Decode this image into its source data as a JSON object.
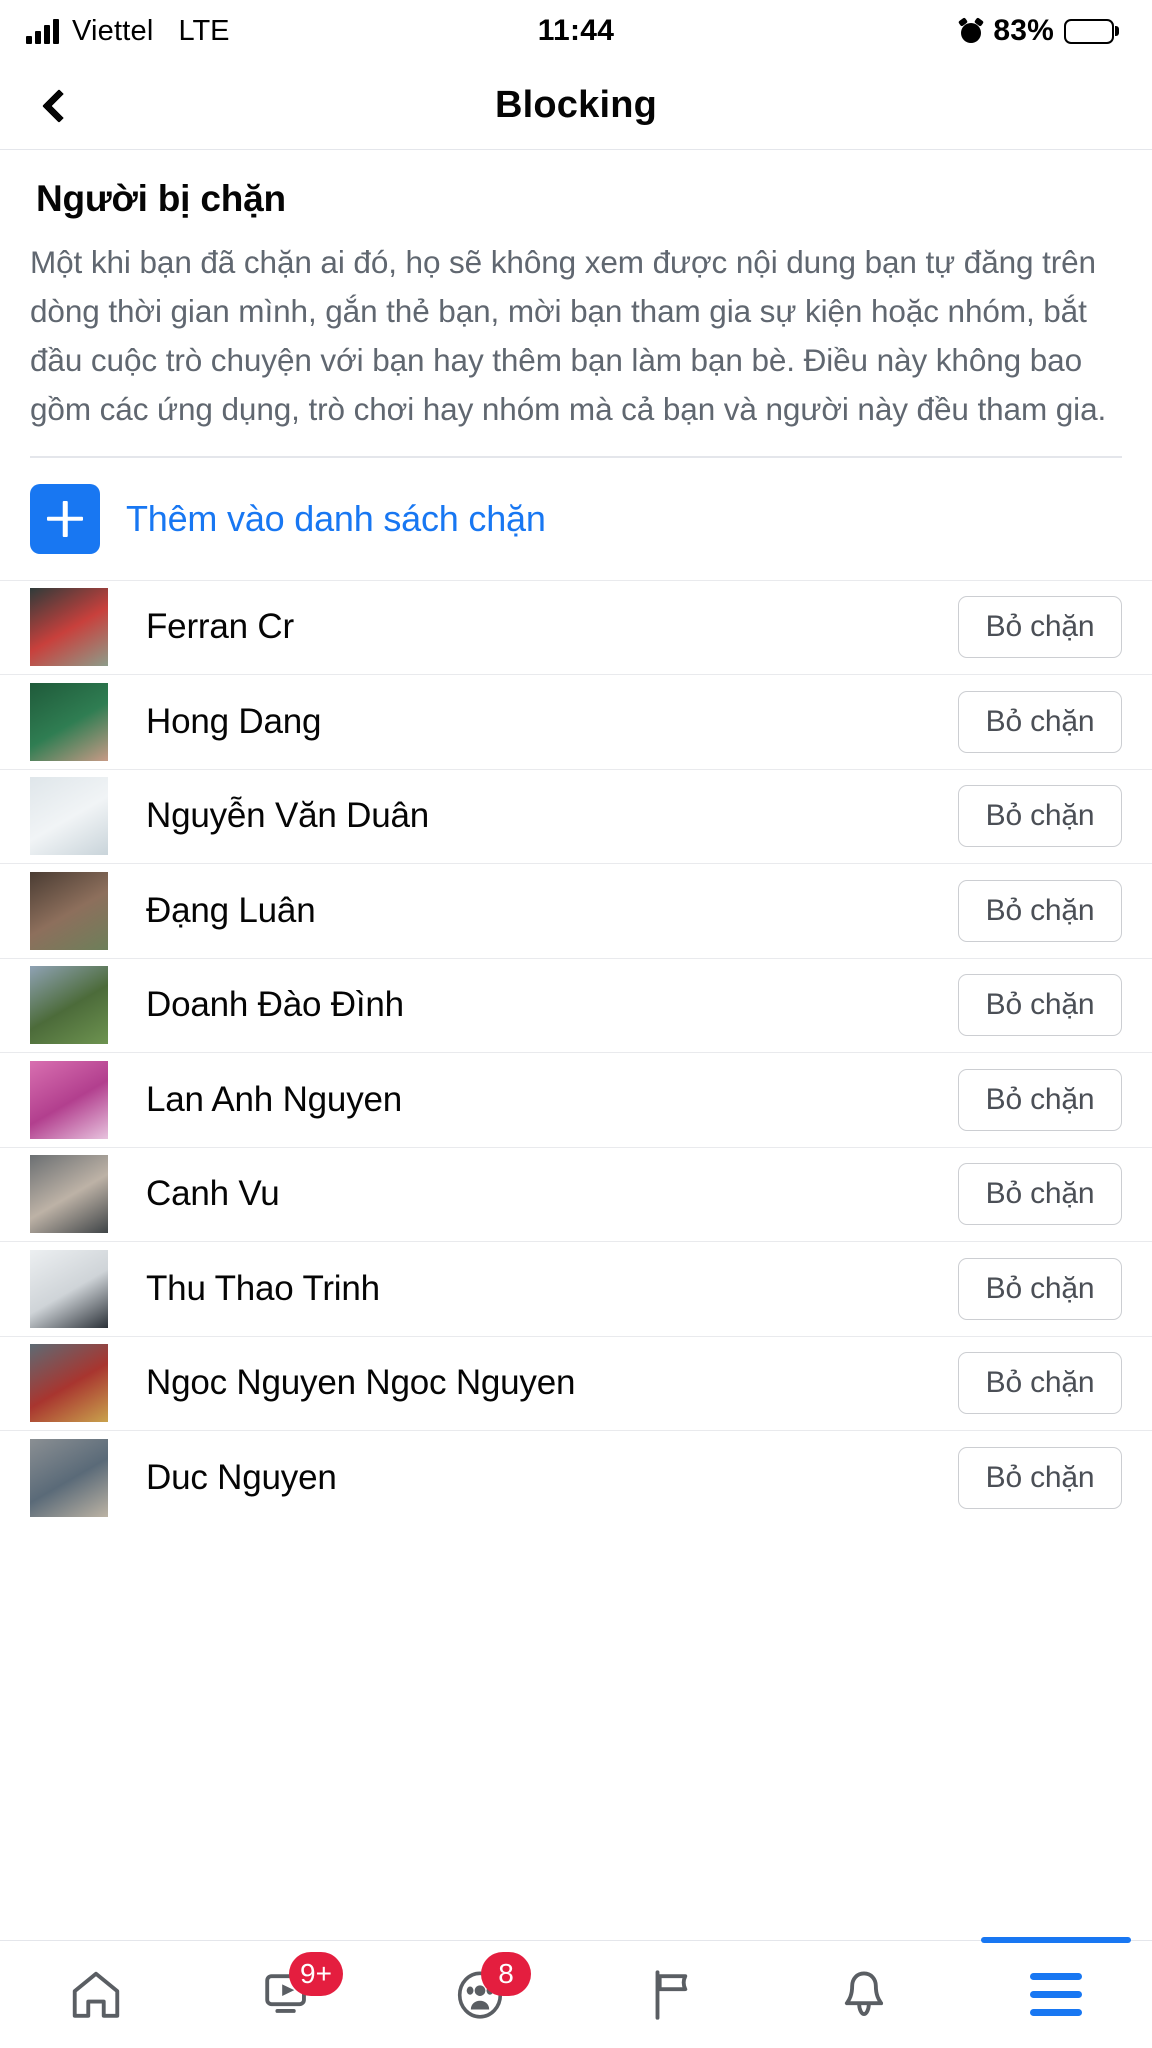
{
  "status_bar": {
    "carrier": "Viettel",
    "network": "LTE",
    "time": "11:44",
    "battery_percent": "83%",
    "alarm_icon": "alarm-icon",
    "signal_icon": "signal-bars-icon",
    "battery_icon": "battery-icon"
  },
  "header": {
    "title": "Blocking",
    "back_icon": "chevron-left-icon"
  },
  "section": {
    "title": "Người bị chặn",
    "description": "Một khi bạn đã chặn ai đó, họ sẽ không xem được nội dung bạn tự đăng trên dòng thời gian mình, gắn thẻ bạn, mời bạn tham gia sự kiện hoặc nhóm, bắt đầu cuộc trò chuyện với bạn hay thêm bạn làm bạn bè. Điều này không bao gồm các ứng dụng, trò chơi hay nhóm mà cả bạn và người này đều tham gia."
  },
  "add_to_block_list": {
    "label": "Thêm vào danh sách chặn",
    "icon": "plus-icon",
    "accent_color": "#1877f2"
  },
  "blocked_people": {
    "unblock_label": "Bỏ chặn",
    "items": [
      {
        "name": "Ferran Cr",
        "avatar_colors": [
          "#2f3b3a",
          "#c8403c",
          "#8d9c8a"
        ]
      },
      {
        "name": "Hong Dang",
        "avatar_colors": [
          "#1f5a3a",
          "#2f7d52",
          "#c79a86"
        ]
      },
      {
        "name": "Nguyễn Văn Duân",
        "avatar_colors": [
          "#dfe6ea",
          "#f1f4f6",
          "#c9d4da"
        ]
      },
      {
        "name": "Đạng Luân",
        "avatar_colors": [
          "#4a3c33",
          "#8d6f5c",
          "#6d7f5a"
        ]
      },
      {
        "name": "Doanh Đào Đình",
        "avatar_colors": [
          "#8fa2b4",
          "#4c6b3a",
          "#6d9350"
        ]
      },
      {
        "name": "Lan Anh Nguyen",
        "avatar_colors": [
          "#d86fb0",
          "#b23f8e",
          "#e7c3de"
        ]
      },
      {
        "name": "Canh Vu",
        "avatar_colors": [
          "#6b6f72",
          "#bdb2a6",
          "#3f4447"
        ]
      },
      {
        "name": "Thu Thao Trinh",
        "avatar_colors": [
          "#eceff1",
          "#cfd4d8",
          "#2b3138"
        ]
      },
      {
        "name": "Ngoc Nguyen Ngoc Nguyen",
        "avatar_colors": [
          "#5d6b74",
          "#a8352f",
          "#c9a24d"
        ]
      },
      {
        "name": "Duc Nguyen",
        "avatar_colors": [
          "#8a8f93",
          "#5a6a78",
          "#bcb3a4"
        ]
      }
    ]
  },
  "tab_bar": {
    "items": [
      {
        "name": "home",
        "icon": "home-icon",
        "badge": "",
        "active": false
      },
      {
        "name": "watch",
        "icon": "video-play-icon",
        "badge": "9+",
        "active": false
      },
      {
        "name": "groups",
        "icon": "people-group-icon",
        "badge": "8",
        "active": false
      },
      {
        "name": "marketplace",
        "icon": "flag-icon",
        "badge": "",
        "active": false
      },
      {
        "name": "notifications",
        "icon": "bell-icon",
        "badge": "",
        "active": false
      },
      {
        "name": "menu",
        "icon": "hamburger-menu-icon",
        "badge": "",
        "active": true
      }
    ],
    "badge_color": "#e41e3f",
    "active_color": "#1877f2"
  }
}
